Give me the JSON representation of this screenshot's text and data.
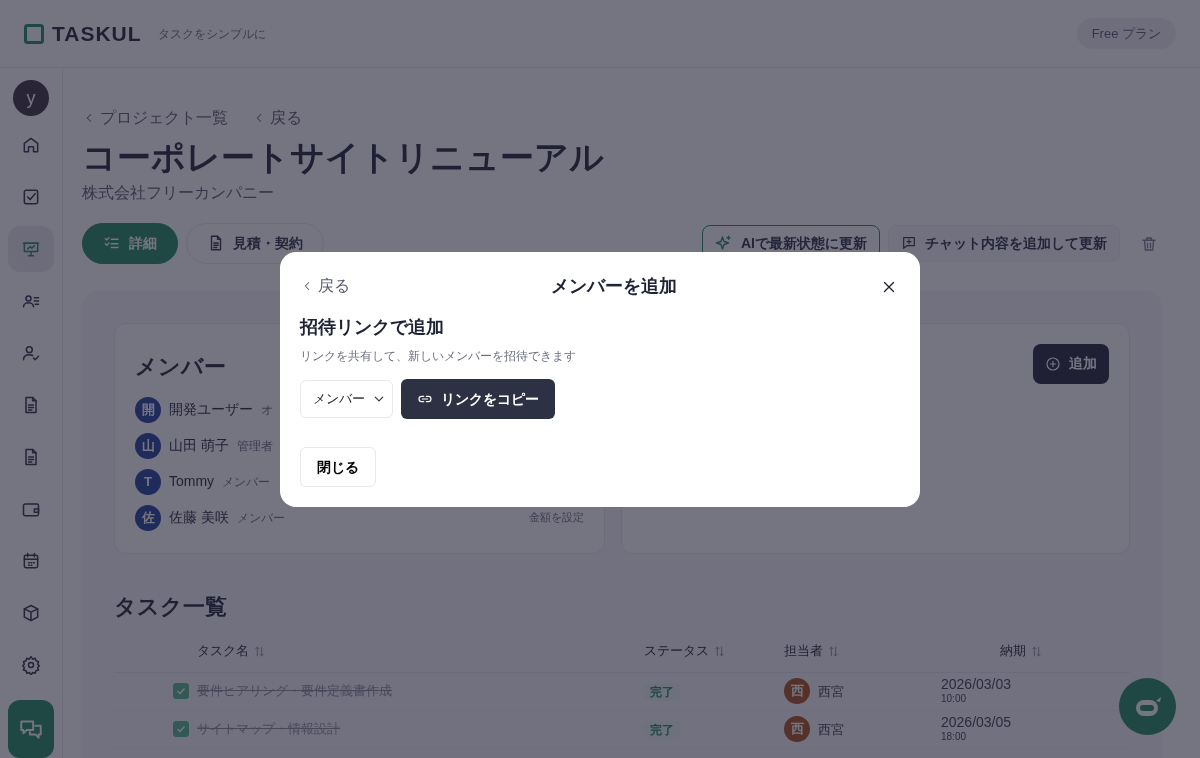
{
  "header": {
    "logo": "TASKUL",
    "tagline": "タスクをシンプルに",
    "plan": "Free プラン"
  },
  "sidebar": {
    "avatar": "y",
    "items": [
      {
        "selected": false
      },
      {
        "selected": false
      },
      {
        "selected": true
      },
      {
        "selected": false
      },
      {
        "selected": false
      },
      {
        "selected": false
      },
      {
        "selected": false
      },
      {
        "selected": false
      },
      {
        "selected": false
      },
      {
        "selected": false
      },
      {
        "selected": false
      }
    ]
  },
  "breadcrumbs": [
    "プロジェクト一覧",
    "戻る"
  ],
  "project": {
    "title": "コーポレートサイトリニューアル",
    "client": "株式会社フリーカンパニー"
  },
  "tabs": [
    {
      "label": "詳細",
      "selected": true
    },
    {
      "label": "見積・契約",
      "selected": false
    }
  ],
  "actions": [
    {
      "kind": "ai",
      "label": "AIで最新状態に更新"
    },
    {
      "kind": "chat",
      "label": "チャット内容を追加して更新"
    },
    {
      "kind": "delete"
    }
  ],
  "members_card": {
    "title": "メンバー",
    "members": [
      {
        "initial": "開",
        "name": "開発ユーザー",
        "role": "オ"
      },
      {
        "initial": "山",
        "name": "山田 萌子",
        "role": "管理者"
      },
      {
        "initial": "T",
        "name": "Tommy",
        "role": "メンバー"
      },
      {
        "initial": "佐",
        "name": "佐藤 美咲",
        "role": "メンバー",
        "action": "金額を設定"
      }
    ]
  },
  "side_card": {
    "button": "追加"
  },
  "tasks": {
    "title": "タスク一覧",
    "columns": [
      "タスク名",
      "ステータス",
      "担当者",
      "納期"
    ],
    "rows": [
      {
        "checked": true,
        "name": "要件ヒアリング・要件定義書作成",
        "status": "完了",
        "assignee_initial": "西",
        "assignee": "西宮",
        "date": "2026/03/03",
        "time": "10:00"
      },
      {
        "checked": true,
        "name": "サイトマップ・情報設計",
        "status": "完了",
        "assignee_initial": "西",
        "assignee": "西宮",
        "date": "2026/03/05",
        "time": "18:00"
      }
    ]
  },
  "modal": {
    "back": "戻る",
    "title": "メンバーを追加",
    "section_title": "招待リンクで追加",
    "description": "リンクを共有して、新しいメンバーを招待できます",
    "role_select": "メンバー",
    "copy_button": "リンクをコピー",
    "close_button": "閉じる"
  }
}
